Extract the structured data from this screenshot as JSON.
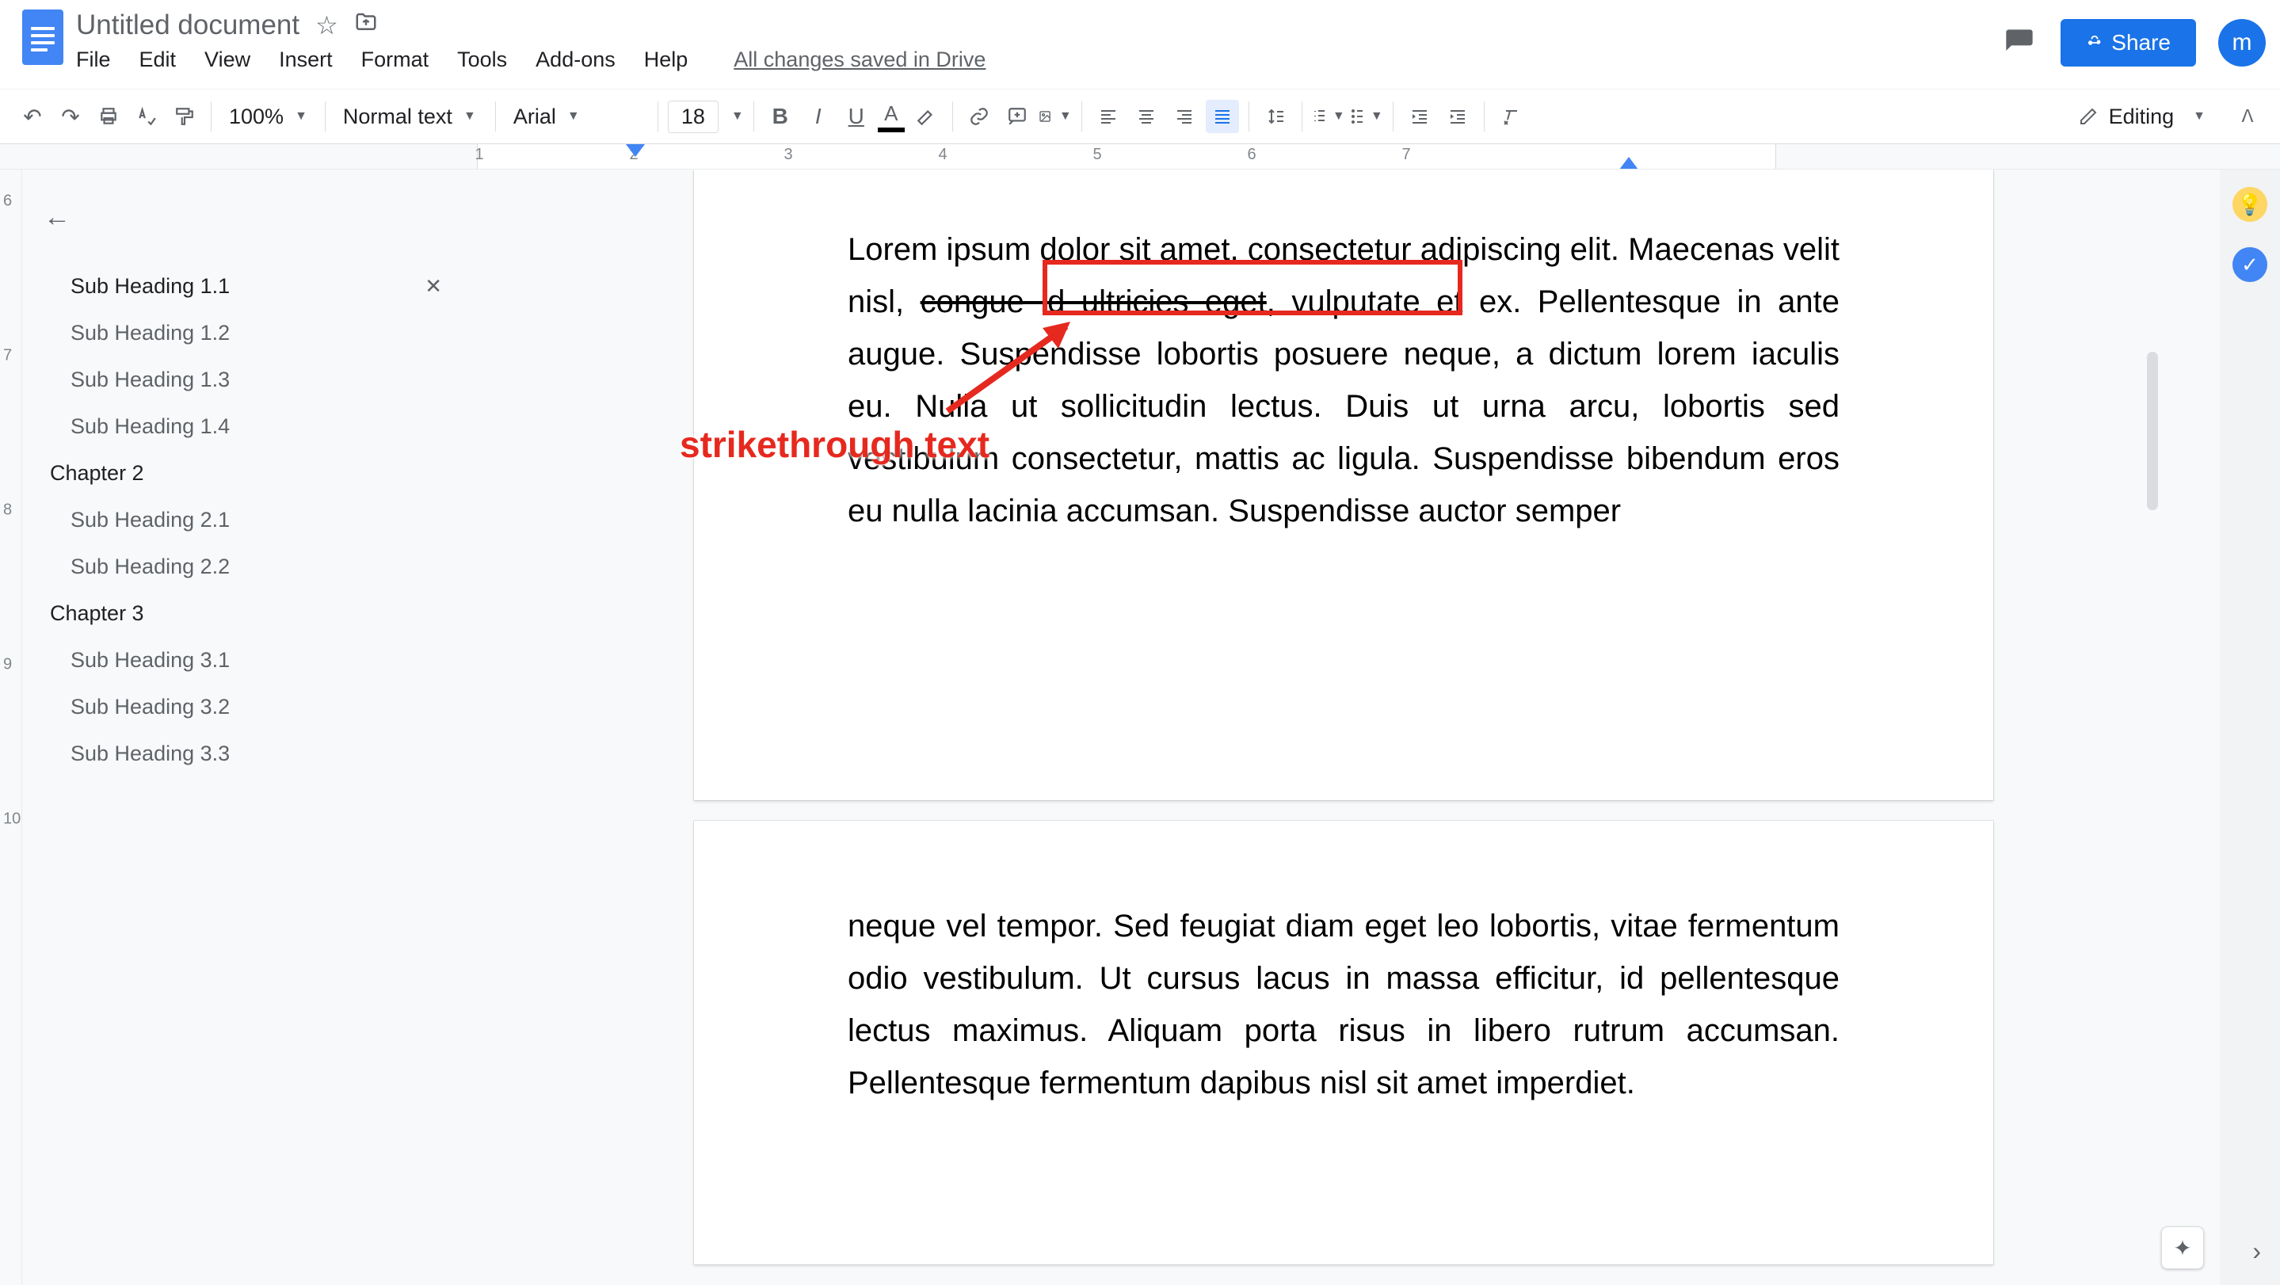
{
  "header": {
    "doc_title": "Untitled document",
    "save_status": "All changes saved in Drive",
    "share_label": "Share",
    "avatar_letter": "m"
  },
  "menu": [
    "File",
    "Edit",
    "View",
    "Insert",
    "Format",
    "Tools",
    "Add-ons",
    "Help"
  ],
  "toolbar": {
    "zoom": "100%",
    "style": "Normal text",
    "font": "Arial",
    "font_size": "18",
    "editing_label": "Editing"
  },
  "ruler": {
    "horizontal": [
      1,
      2,
      3,
      4,
      5,
      6,
      7
    ],
    "vertical": [
      6,
      7,
      8,
      9,
      10
    ]
  },
  "outline": [
    {
      "label": "Sub Heading 1.1",
      "level": "sub",
      "active": true
    },
    {
      "label": "Sub Heading 1.2",
      "level": "sub"
    },
    {
      "label": "Sub Heading 1.3",
      "level": "sub"
    },
    {
      "label": "Sub Heading 1.4",
      "level": "sub"
    },
    {
      "label": "Chapter 2",
      "level": "chapter"
    },
    {
      "label": "Sub Heading 2.1",
      "level": "sub"
    },
    {
      "label": "Sub Heading 2.2",
      "level": "sub"
    },
    {
      "label": "Chapter 3",
      "level": "chapter"
    },
    {
      "label": "Sub Heading 3.1",
      "level": "sub"
    },
    {
      "label": "Sub Heading 3.2",
      "level": "sub"
    },
    {
      "label": "Sub Heading 3.3",
      "level": "sub"
    }
  ],
  "doc": {
    "page1_pre": "Lorem ipsum dolor sit amet, consectetur adipiscing elit. Maecenas velit nisl, ",
    "page1_strike": "congue id ultricies eget",
    "page1_post": ", vulputate et ex. Pellentesque in ante augue. Suspendisse lobortis posuere neque, a dictum lorem iaculis eu. Nulla ut sollicitudin lectus. Duis ut urna arcu, lobortis sed vestibulum consectetur, mattis ac ligula. Suspendisse bibendum eros eu nulla lacinia accumsan. Suspendisse auctor semper",
    "page2": "neque vel tempor. Sed feugiat diam eget leo lobortis, vitae fermentum odio vestibulum. Ut cursus lacus in massa efficitur, id pellentesque lectus maximus. Aliquam porta risus in libero rutrum accumsan. Pellentesque fermentum dapibus nisl sit amet imperdiet."
  },
  "annotation": {
    "label": "strikethrough text"
  }
}
